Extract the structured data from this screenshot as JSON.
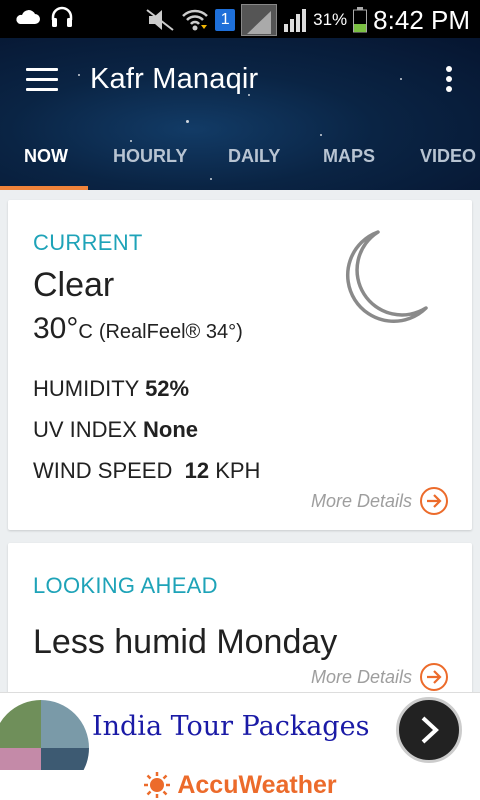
{
  "status_bar": {
    "battery_percent": "31%",
    "time": "8:42 PM",
    "sim_slot": "1"
  },
  "header": {
    "location": "Kafr Manaqir",
    "tabs": [
      {
        "label": "NOW",
        "active": true
      },
      {
        "label": "HOURLY",
        "active": false
      },
      {
        "label": "DAILY",
        "active": false
      },
      {
        "label": "MAPS",
        "active": false
      },
      {
        "label": "VIDEO",
        "active": false
      }
    ]
  },
  "current": {
    "section_title": "CURRENT",
    "condition": "Clear",
    "temperature": "30°",
    "unit": "C",
    "realfeel": "(RealFeel® 34°)",
    "humidity_label": "HUMIDITY",
    "humidity_value": "52%",
    "uv_label": "UV INDEX",
    "uv_value": "None",
    "wind_label": "WIND SPEED",
    "wind_value": "12",
    "wind_unit": "KPH",
    "more_details": "More Details",
    "icon": "moon-icon"
  },
  "looking_ahead": {
    "section_title": "LOOKING AHEAD",
    "headline": "Less humid Monday",
    "more_details": "More Details"
  },
  "ad": {
    "text": "h India Tour Packages"
  },
  "brand": {
    "name": "AccuWeather"
  },
  "colors": {
    "accent": "#ec6b2b",
    "section_title": "#1ea3b8",
    "header_bg": "#0a2444"
  }
}
